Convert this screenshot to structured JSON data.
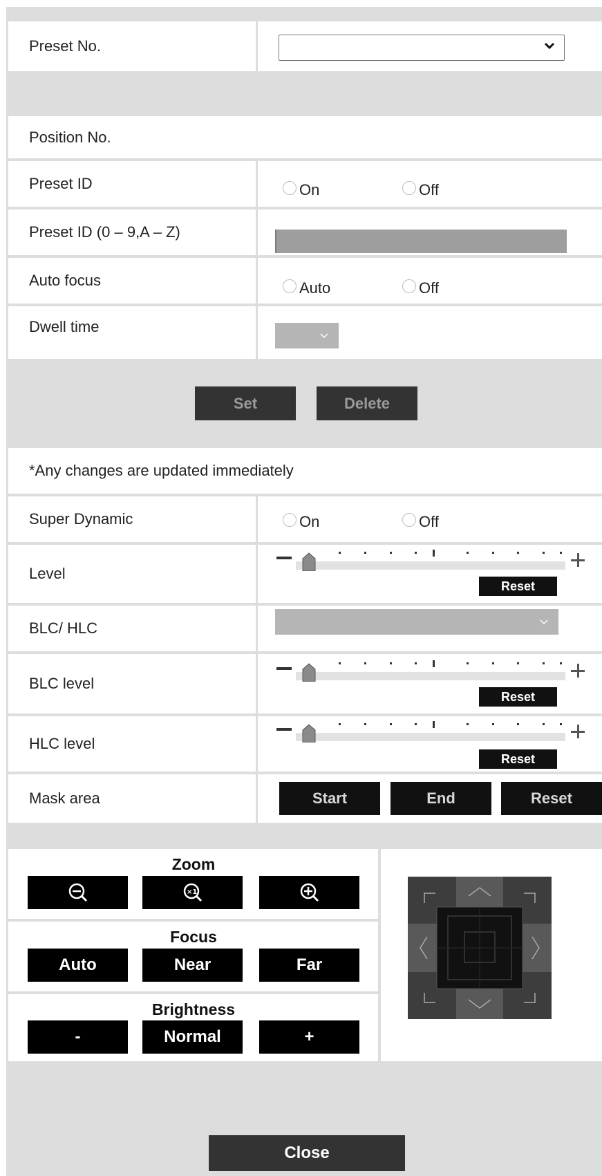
{
  "preset": {
    "label": "Preset No.",
    "selected": ""
  },
  "position": {
    "label": "Position No."
  },
  "preset_id": {
    "label": "Preset ID",
    "on": "On",
    "off": "Off"
  },
  "preset_id_text": {
    "label": "Preset ID (0 – 9,A – Z)",
    "value": ""
  },
  "auto_focus": {
    "label": "Auto focus",
    "auto": "Auto",
    "off": "Off"
  },
  "dwell": {
    "label": "Dwell time",
    "value": ""
  },
  "actions": {
    "set": "Set",
    "delete": "Delete"
  },
  "notice": "*Any changes are updated immediately",
  "super_dynamic": {
    "label": "Super Dynamic",
    "on": "On",
    "off": "Off"
  },
  "level": {
    "label": "Level",
    "reset": "Reset",
    "min_symbol": "−",
    "max_symbol": "+"
  },
  "blc_hlc": {
    "label": "BLC/ HLC",
    "value": ""
  },
  "blc_level": {
    "label": "BLC level",
    "reset": "Reset"
  },
  "hlc_level": {
    "label": "HLC level",
    "reset": "Reset"
  },
  "mask_area": {
    "label": "Mask area",
    "start": "Start",
    "end": "End",
    "reset": "Reset"
  },
  "zoom": {
    "title": "Zoom",
    "icons": [
      "zoom-out-icon",
      "zoom-x1-icon",
      "zoom-in-icon"
    ]
  },
  "focus": {
    "title": "Focus",
    "auto": "Auto",
    "near": "Near",
    "far": "Far"
  },
  "brightness": {
    "title": "Brightness",
    "minus": "-",
    "normal": "Normal",
    "plus": "+"
  },
  "close": "Close",
  "colors": {
    "panel": "#dddddd",
    "button": "#111111",
    "disabled_fill": "#9e9e9e"
  }
}
